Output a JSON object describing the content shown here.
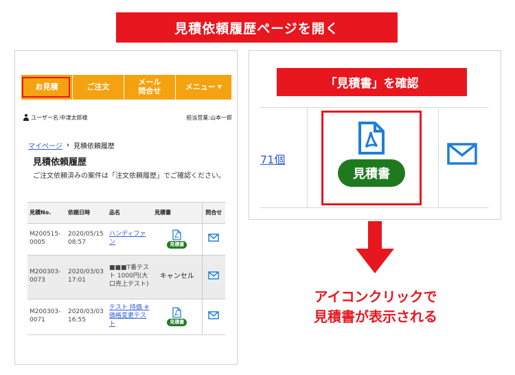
{
  "header_banner": "見積依頼履歴ページを開く",
  "phone": {
    "nav": {
      "quote": "お見積",
      "order": "ご注文",
      "mail_line1": "メール",
      "mail_line2": "問合せ",
      "menu": "メニュー"
    },
    "user_label": "ユーザー名:中津太郎様",
    "sales_label": "担当営業:山本一郎",
    "breadcrumb": {
      "mypage": "マイページ",
      "sep": "›",
      "current": "見積依頼履歴"
    },
    "title": "見積依頼履歴",
    "description": "ご注文依頼済みの案件は「注文依頼履歴」でご確認ください。",
    "table": {
      "headers": {
        "no": "見積No.",
        "date": "依頼日時",
        "name": "品名",
        "doc": "見積書",
        "mail": "問合せ"
      },
      "rows": [
        {
          "no": "M200515-0005",
          "date": "2020/05/15 08:57",
          "name": "ハンディファン",
          "doc": "見積書"
        },
        {
          "no": "M200303-0073",
          "date": "2020/03/03 17:01",
          "name": "■■■T番テスト 1000円(大口売上テスト)",
          "doc": "キャンセル"
        },
        {
          "no": "M200303-0071",
          "date": "2020/03/03 16:55",
          "name": "テスト 持価 ※価格変更テスト",
          "doc": "見積書"
        }
      ]
    }
  },
  "zoom": {
    "banner": "「見積書」を確認",
    "qty_text": "71個",
    "doc_label": "見積書"
  },
  "caption_line1": "アイコンクリックで",
  "caption_line2": "見積書が表示される",
  "colors": {
    "accent_red": "#e8161e",
    "nav_orange": "#f5a210",
    "pill_green": "#1f7a1f",
    "icon_blue": "#1e7fd6"
  }
}
